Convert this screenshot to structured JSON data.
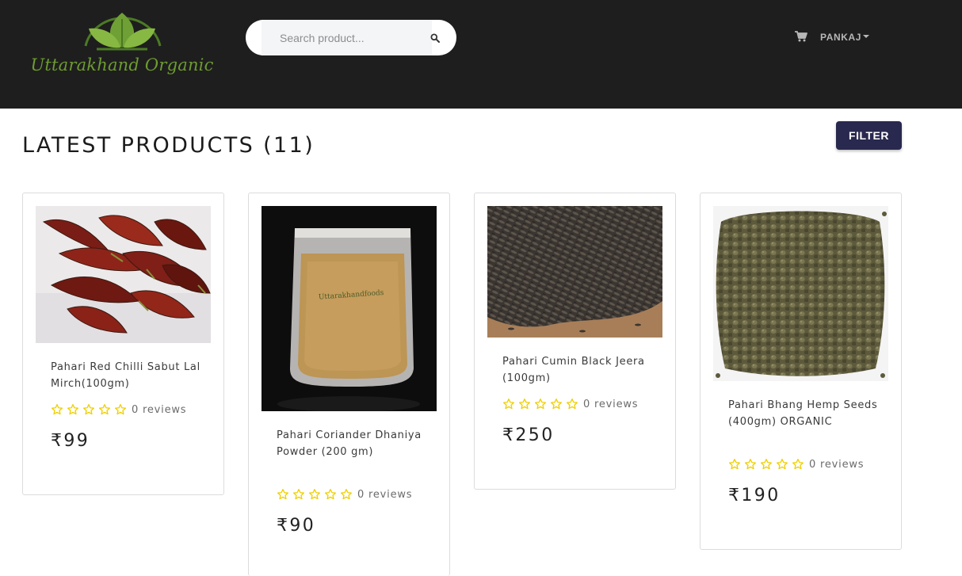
{
  "header": {
    "logo_text": "Uttarakhand Organic",
    "search": {
      "placeholder": "Search product..."
    },
    "user_name": "PANKAJ"
  },
  "main": {
    "title": "LATEST PRODUCTS (11)",
    "filter_label": "FILTER"
  },
  "colors": {
    "header_bg": "#1e1e1e",
    "filter_bg": "#29284e",
    "star": "#f0d000",
    "logo_green": "#6d9c2f"
  },
  "products": [
    {
      "title": "Pahari Red Chilli Sabut Lal Mirch(100gm)",
      "rating": 0,
      "reviews": "0 reviews",
      "price": "₹99",
      "image": "red-chillies-photo"
    },
    {
      "title": "Pahari Coriander Dhaniya Powder (200 gm)",
      "rating": 0,
      "reviews": "0 reviews",
      "price": "₹90",
      "image": "coriander-powder-pouch-photo",
      "pouch_text": "Uttarakhandfoods"
    },
    {
      "title": "Pahari Cumin Black Jeera (100gm)",
      "rating": 0,
      "reviews": "0 reviews",
      "price": "₹250",
      "image": "black-cumin-seeds-photo"
    },
    {
      "title": "Pahari Bhang Hemp Seeds (400gm) ORGANIC",
      "rating": 0,
      "reviews": "0 reviews",
      "price": "₹190",
      "image": "hemp-seeds-photo"
    }
  ]
}
